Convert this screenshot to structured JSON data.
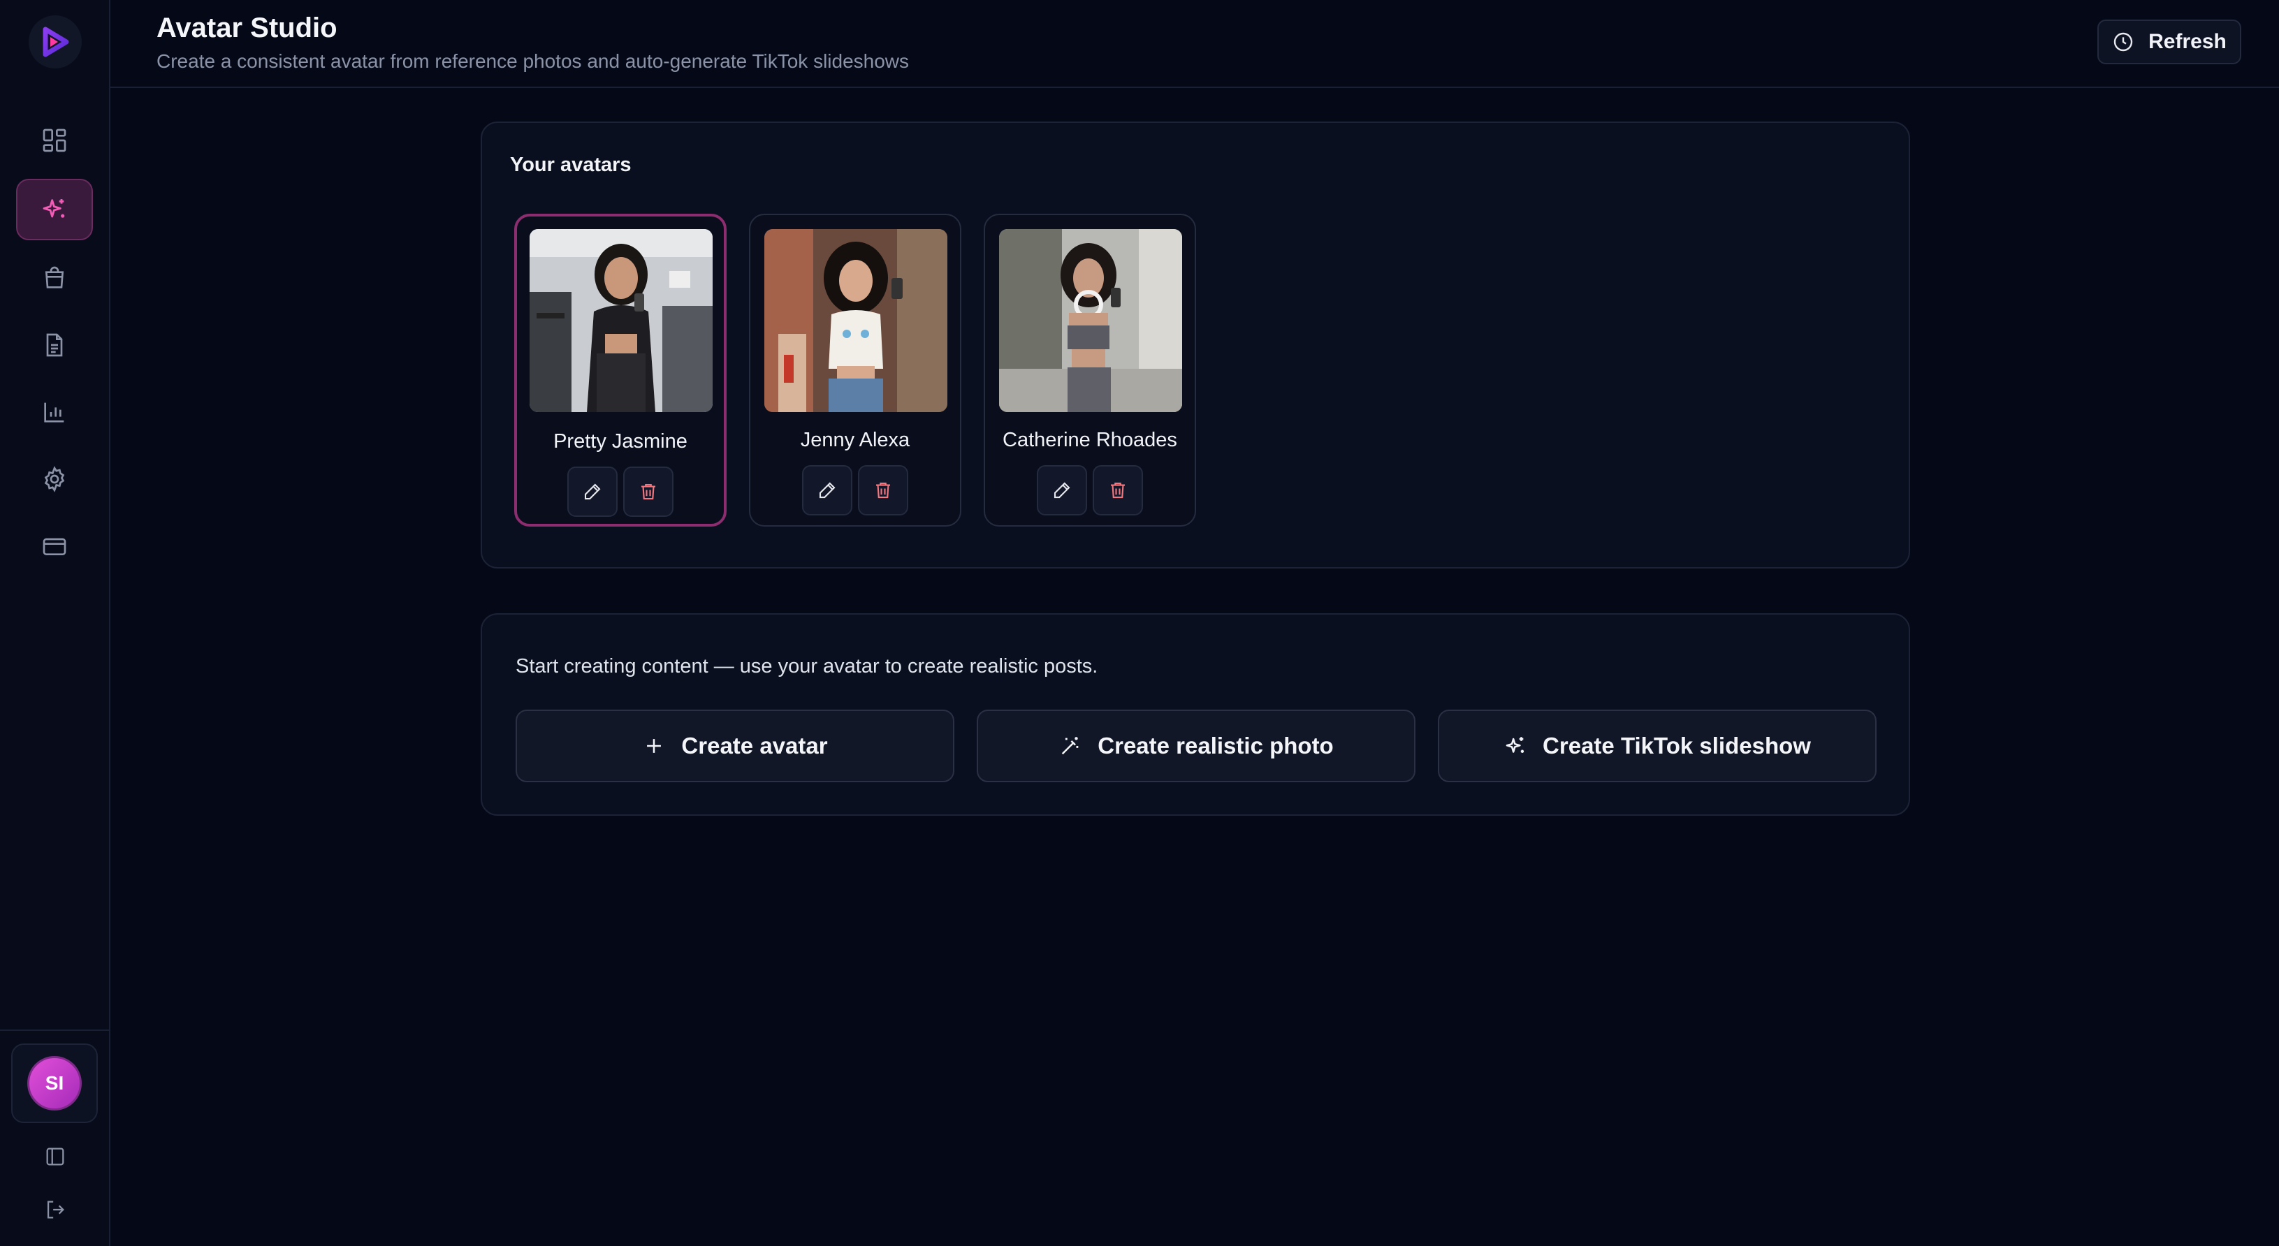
{
  "app": {
    "title": "Avatar Studio",
    "subtitle": "Create a consistent avatar from reference photos and auto-generate TikTok slideshows",
    "refresh_label": "Refresh"
  },
  "sidebar": {
    "items": [
      {
        "name": "dashboard",
        "icon": "dashboard-icon",
        "active": false
      },
      {
        "name": "avatar-studio",
        "icon": "sparkles-icon",
        "active": true
      },
      {
        "name": "shop",
        "icon": "shopping-bag-icon",
        "active": false
      },
      {
        "name": "documents",
        "icon": "document-icon",
        "active": false
      },
      {
        "name": "analytics",
        "icon": "bar-chart-icon",
        "active": false
      },
      {
        "name": "settings",
        "icon": "gear-icon",
        "active": false
      },
      {
        "name": "billing",
        "icon": "credit-card-icon",
        "active": false
      }
    ],
    "user_initials": "SI"
  },
  "avatars_panel": {
    "heading": "Your avatars",
    "avatars": [
      {
        "name": "Pretty Jasmine",
        "selected": true
      },
      {
        "name": "Jenny Alexa",
        "selected": false
      },
      {
        "name": "Catherine Rhoades",
        "selected": false
      }
    ]
  },
  "create_panel": {
    "text": "Start creating content — use your avatar to create realistic posts.",
    "buttons": [
      {
        "label": "Create avatar",
        "icon": "plus-icon"
      },
      {
        "label": "Create realistic photo",
        "icon": "magic-wand-icon"
      },
      {
        "label": "Create TikTok slideshow",
        "icon": "sparkles-icon"
      }
    ]
  },
  "colors": {
    "background": "#050816",
    "accent": "#e14fd8",
    "active_nav": "#3a1a3c",
    "delete_icon": "#f2777f"
  }
}
